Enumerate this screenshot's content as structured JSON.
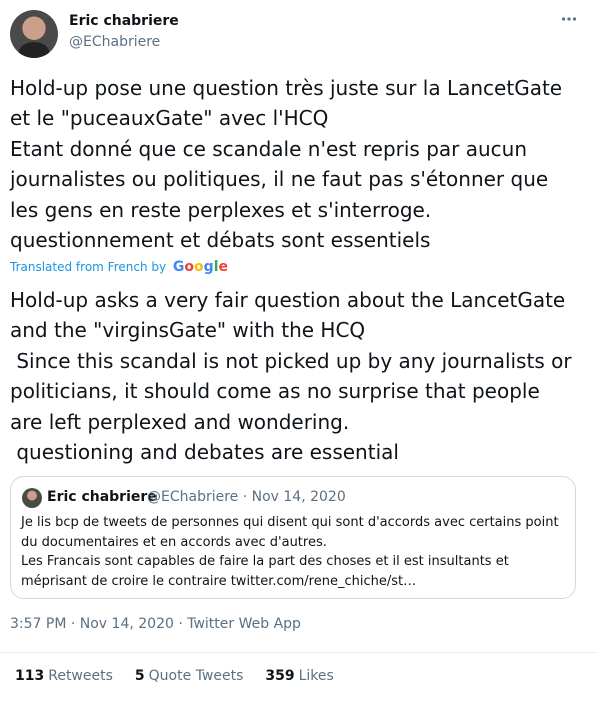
{
  "author": {
    "name": "Eric chabriere",
    "handle": "@EChabriere",
    "more_icon": "ellipsis-icon"
  },
  "tweet": {
    "text": "Hold-up pose une question très juste sur la LancetGate\net le \"puceauxGate\" avec l'HCQ\nEtant donné que ce scandale n'est repris par aucun\njournalistes ou politiques, il ne faut pas s'étonner que\nles gens en reste perplexes et s'interroge.\nquestionnement et débats sont essentiels",
    "translated_label": "Translated from French by",
    "translator": {
      "g1": "G",
      "o1": "o",
      "o2": "o",
      "g2": "g",
      "l": "l",
      "e": "e"
    },
    "translation": "Hold-up asks a very fair question about the LancetGate\nand the \"virginsGate\" with the HCQ\n Since this scandal is not picked up by any journalists or\npoliticians, it should come as no surprise that people\nare left perplexed and wondering.\n questioning and debates are essential"
  },
  "quote": {
    "name": "Eric chabriere",
    "meta": "@EChabriere · Nov 14, 2020",
    "text": "Je lis bcp de tweets de personnes qui disent qui sont d'accords avec certains point\ndu documentaires et en accords avec d'autres.\nLes Francais sont capables de faire la part des choses et il est insultants et\nméprisant de croire le contraire twitter.com/rene_chiche/st…"
  },
  "meta": {
    "time": "3:57 PM · Nov 14, 2020 · ",
    "source": "Twitter Web App"
  },
  "stats": {
    "retweets_count": "113",
    "retweets_label": "Retweets",
    "quotes_count": "5",
    "quotes_label": "Quote Tweets",
    "likes_count": "359",
    "likes_label": "Likes"
  },
  "colors": {
    "link": "#1b95e0",
    "secondary_text": "#5b7083",
    "primary_text": "#0f1419",
    "border": "#cfd9de"
  }
}
